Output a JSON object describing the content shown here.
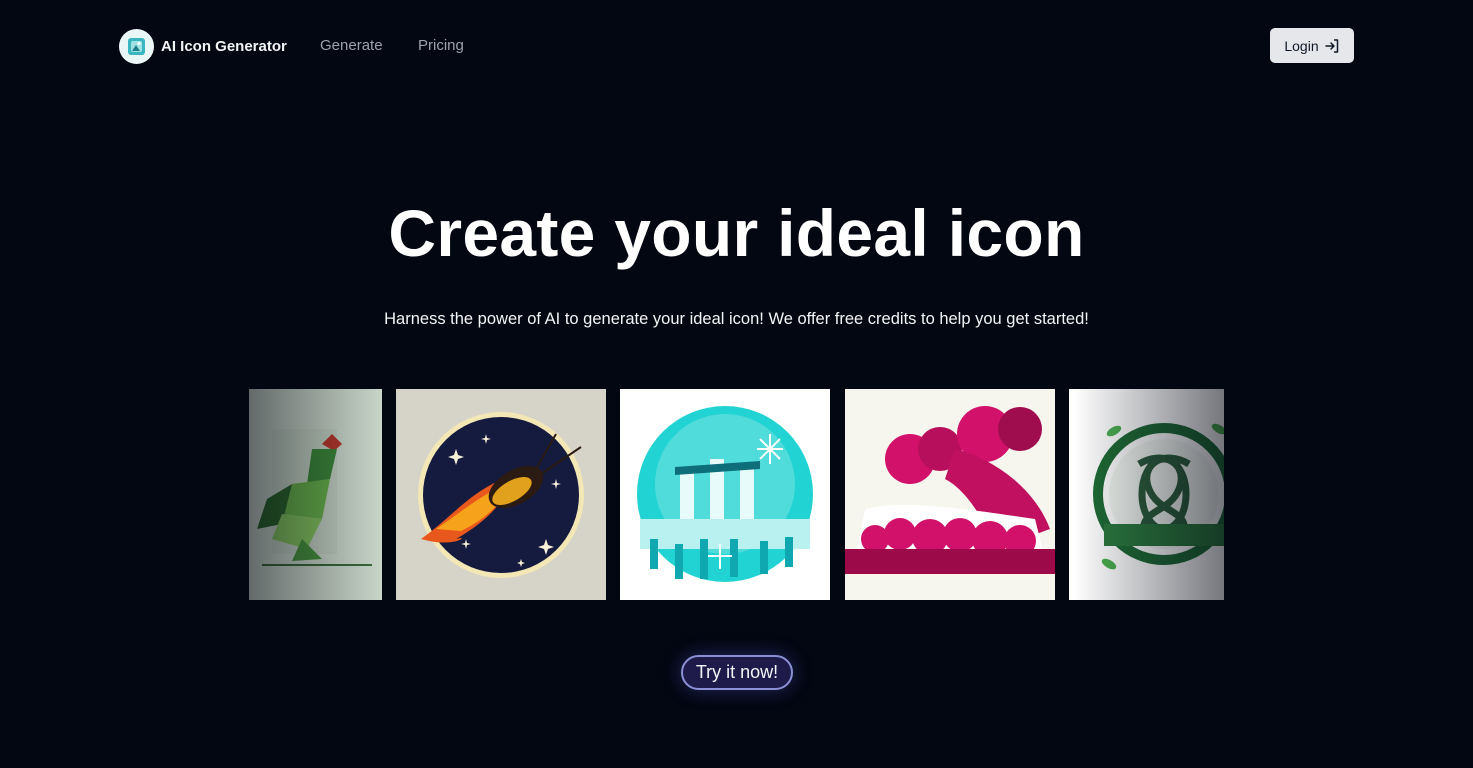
{
  "nav": {
    "brand": "AI Icon Generator",
    "logo_icon": "ai-app-logo-icon",
    "links": [
      "Generate",
      "Pricing"
    ],
    "login_label": "Login",
    "login_icon": "login-arrow-icon"
  },
  "hero": {
    "title": "Create your ideal icon",
    "subtitle": "Harness the power of AI to generate your ideal icon! We offer free credits to help you get started!"
  },
  "gallery": {
    "items": [
      {
        "icon": "geometric-rooster-icon",
        "bg": "#d6e3d4"
      },
      {
        "icon": "flaming-beetle-icon",
        "bg": "#d6d3c9"
      },
      {
        "icon": "icy-marina-bay-icon",
        "bg": "#ffffff"
      },
      {
        "icon": "magenta-clouds-icon",
        "bg": "#f7f6ee"
      },
      {
        "icon": "celtic-knot-icon",
        "bg": "#ffffff"
      }
    ]
  },
  "cta": {
    "label": "Try it now!"
  },
  "colors": {
    "background": "#030712",
    "cta_border": "#8b8fd6",
    "login_bg": "#e5e7eb"
  }
}
